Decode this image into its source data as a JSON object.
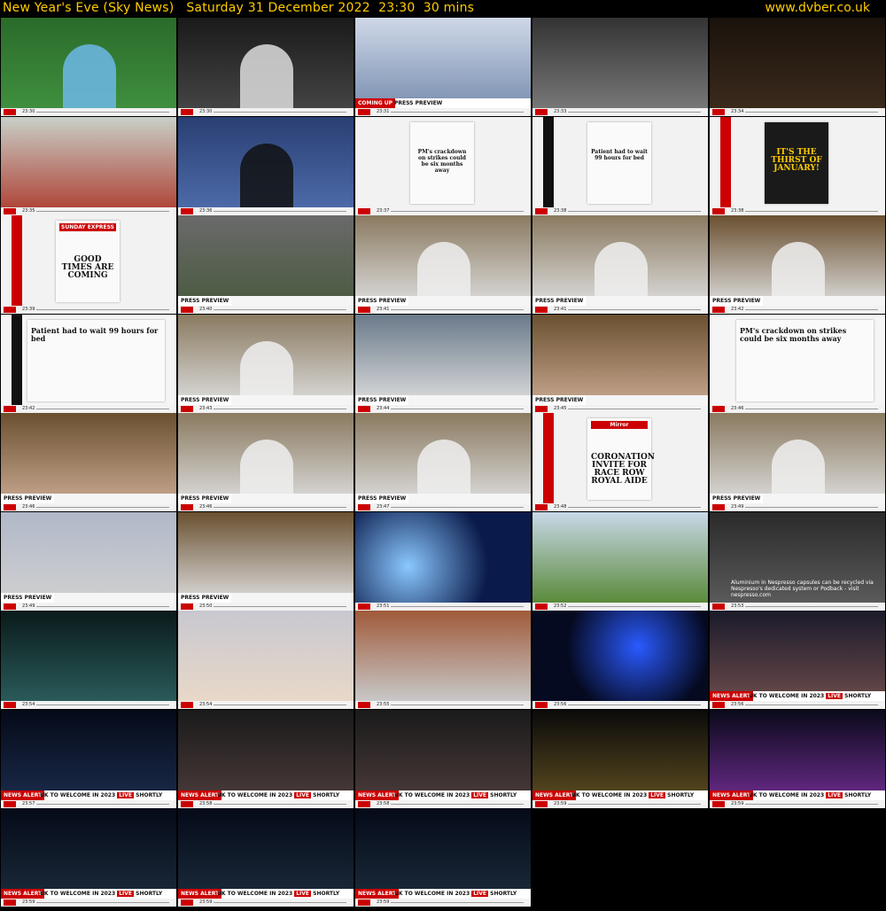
{
  "header": {
    "title": "New Year's Eve (Sky News)   Saturday 31 December 2022  23:30  30 mins",
    "site": "www.dvber.co.uk"
  },
  "banners": {
    "coming_up": "COMING UP",
    "press_preview": "PRESS PREVIEW",
    "news_alert": "NEWS ALERT",
    "uk_headline": "UK TO WELCOME IN 2023",
    "live": "LIVE",
    "shortly": "SHORTLY"
  },
  "papers": {
    "sunday_express_title": "SUNDAY EXPRESS",
    "sunday_express_headline": "GOOD TIMES ARE COMING",
    "daily_star_headline": "IT'S THE THIRST OF JANUARY!",
    "times_headline": "Patient had to wait 99 hours for bed",
    "telegraph_headline": "PM's crackdown on strikes could be six months away",
    "mirror_title": "Mirror",
    "mirror_headline": "CORONATION INVITE FOR RACE ROW ROYAL AIDE"
  },
  "captions": {
    "nespresso": "Aluminium in Nespresso capsules can be recycled via Nespresso's dedicated system or Podback - visit nespresso.com"
  },
  "timestamps": [
    "23:30",
    "23:30",
    "23:31",
    "23:33",
    "23:34",
    "23:35",
    "23:36",
    "23:37",
    "23:38",
    "23:38",
    "23:39",
    "23:40",
    "23:41",
    "23:41",
    "23:42",
    "23:42",
    "23:43",
    "23:44",
    "23:45",
    "23:46",
    "23:46",
    "23:46",
    "23:47",
    "23:48",
    "23:49",
    "23:49",
    "23:50",
    "23:51",
    "23:52",
    "23:53",
    "23:54",
    "23:54",
    "23:55",
    "23:56",
    "23:56",
    "23:57",
    "23:58",
    "23:58",
    "23:59"
  ],
  "colors": {
    "header_text": "#ffcc00",
    "sky_red": "#cc0000"
  }
}
